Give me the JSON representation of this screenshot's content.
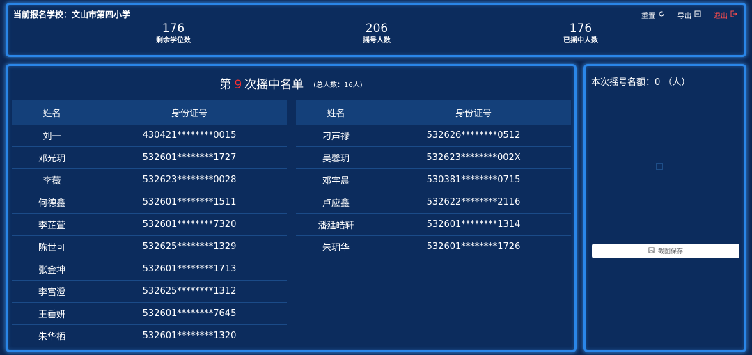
{
  "header": {
    "school_label": "当前报名学校：文山市第四小学",
    "actions": {
      "reset": "重置",
      "export": "导出",
      "logout": "退出"
    }
  },
  "stats": {
    "remaining": {
      "value": "176",
      "label": "剩余学位数"
    },
    "applicants": {
      "value": "206",
      "label": "摇号人数"
    },
    "selected": {
      "value": "176",
      "label": "已摇中人数"
    }
  },
  "list": {
    "title_prefix": "第",
    "round": "9",
    "title_suffix": "次摇中名单",
    "total": "(总人数：16人)",
    "columns": {
      "name": "姓名",
      "id": "身份证号"
    },
    "left": [
      {
        "name": "刘一",
        "id": "430421********0015"
      },
      {
        "name": "邓光玥",
        "id": "532601********1727"
      },
      {
        "name": "李薇",
        "id": "532623********0028"
      },
      {
        "name": "何德鑫",
        "id": "532601********1511"
      },
      {
        "name": "李芷萱",
        "id": "532601********7320"
      },
      {
        "name": "陈世可",
        "id": "532625********1329"
      },
      {
        "name": "张金坤",
        "id": "532601********1713"
      },
      {
        "name": "李富澄",
        "id": "532625********1312"
      },
      {
        "name": "王垂妍",
        "id": "532601********7645"
      },
      {
        "name": "朱华栖",
        "id": "532601********1320"
      }
    ],
    "right": [
      {
        "name": "刁声禄",
        "id": "532626********0512"
      },
      {
        "name": "吴馨玥",
        "id": "532623********002X"
      },
      {
        "name": "邓宇晨",
        "id": "530381********0715"
      },
      {
        "name": "卢应鑫",
        "id": "532622********2116"
      },
      {
        "name": "潘廷皓轩",
        "id": "532601********1314"
      },
      {
        "name": "朱玥华",
        "id": "532601********1726"
      }
    ]
  },
  "side": {
    "quota": "本次摇号名额：0 （人）",
    "save_label": "截图保存"
  },
  "colors": {
    "accent": "#2a86e8",
    "highlight": "#ff3030",
    "background": "#0c2754"
  }
}
